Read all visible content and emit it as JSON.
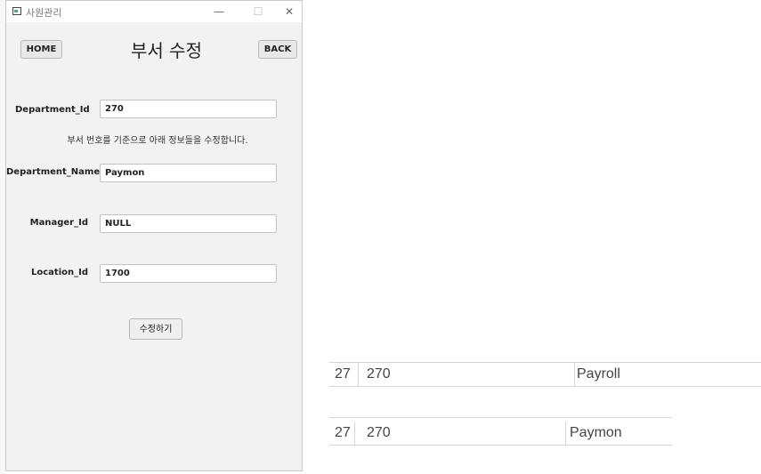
{
  "window": {
    "title": "사원관리",
    "controls": {
      "minimize": "—",
      "maximize": "☐",
      "close": "✕"
    }
  },
  "header": {
    "home_label": "HOME",
    "title": "부서 수정",
    "back_label": "BACK"
  },
  "form": {
    "department_id": {
      "label": "Department_Id",
      "value": "270"
    },
    "hint": "부서 번호를 기준으로 아래 정보들을 수정합니다.",
    "department_name": {
      "label": "Department_Name",
      "value": "Paymon"
    },
    "manager_id": {
      "label": "Manager_Id",
      "value": "NULL"
    },
    "location_id": {
      "label": "Location_Id",
      "value": "1700"
    },
    "submit_label": "수정하기"
  },
  "background_grid": {
    "rows": [
      {
        "num": "27",
        "id": "270",
        "name": "Payroll"
      },
      {
        "num": "27",
        "id": "270",
        "name": "Paymon"
      }
    ]
  },
  "icons": [
    "app-window-icon"
  ]
}
